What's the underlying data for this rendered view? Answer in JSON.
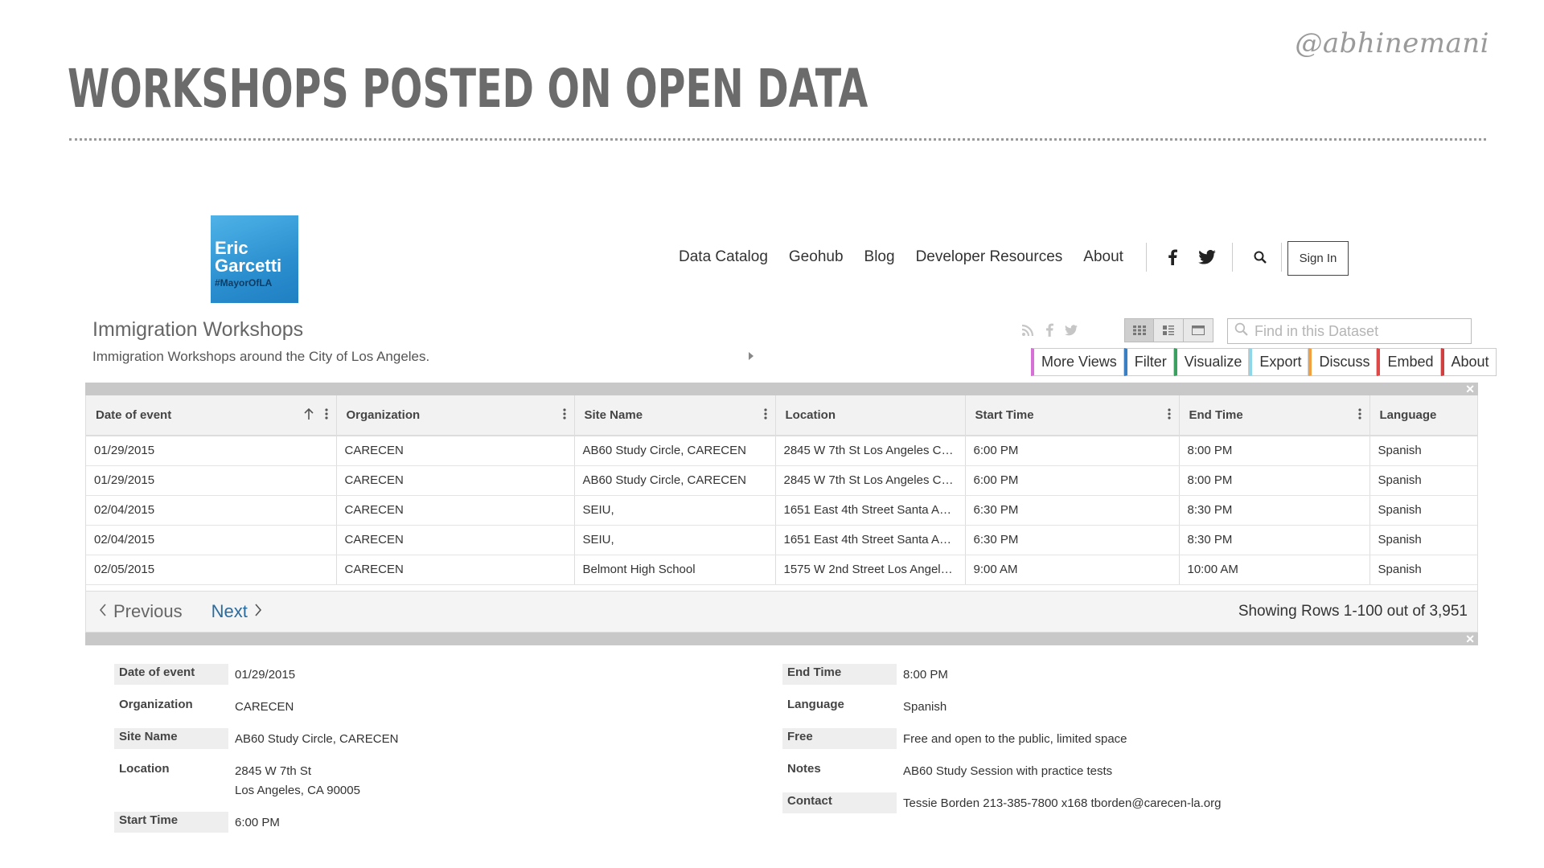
{
  "slide": {
    "handle": "@abhinemani",
    "title": "WORKSHOPS POSTED ON OPEN DATA"
  },
  "site": {
    "logo": {
      "line1": "Eric",
      "line2": "Garcetti",
      "line3": "#MayorOfLA",
      "colors": [
        "#4fb3e8",
        "#1f7fc2"
      ]
    },
    "nav": [
      "Data Catalog",
      "Geohub",
      "Blog",
      "Developer Resources",
      "About"
    ],
    "social_icons": [
      "facebook-icon",
      "twitter-icon"
    ],
    "sign_in": "Sign In"
  },
  "dataset": {
    "title": "Immigration Workshops",
    "description": "Immigration Workshops around the City of Los Angeles.",
    "search_placeholder": "Find in this Dataset",
    "share_icons": [
      "rss-icon",
      "facebook-icon",
      "twitter-icon"
    ],
    "views": [
      "table-view-icon",
      "list-view-icon",
      "page-view-icon"
    ],
    "actions": [
      {
        "label": "More Views",
        "color": "#d670d6"
      },
      {
        "label": "Filter",
        "color": "#3a7fc4"
      },
      {
        "label": "Visualize",
        "color": "#3aa060"
      },
      {
        "label": "Export",
        "color": "#8fd6e8"
      },
      {
        "label": "Discuss",
        "color": "#f0a040"
      },
      {
        "label": "Embed",
        "color": "#e04848"
      },
      {
        "label": "About",
        "color": "#d04040"
      }
    ]
  },
  "grid": {
    "columns": [
      "Date of event",
      "Organization",
      "Site Name",
      "Location",
      "Start Time",
      "End Time",
      "Language"
    ],
    "rows": [
      [
        "01/29/2015",
        "CARECEN",
        "AB60 Study Circle, CARECEN",
        "2845 W 7th St Los Angeles CA ...",
        "6:00 PM",
        "8:00 PM",
        "Spanish"
      ],
      [
        "01/29/2015",
        "CARECEN",
        "AB60 Study Circle, CARECEN",
        "2845 W 7th St Los Angeles CA ...",
        "6:00 PM",
        "8:00 PM",
        "Spanish"
      ],
      [
        "02/04/2015",
        "CARECEN",
        "SEIU,",
        "1651 East 4th Street Santa Ana...",
        "6:30 PM",
        "8:30 PM",
        "Spanish"
      ],
      [
        "02/04/2015",
        "CARECEN",
        "SEIU,",
        "1651 East 4th Street Santa Ana...",
        "6:30 PM",
        "8:30 PM",
        "Spanish"
      ],
      [
        "02/05/2015",
        "CARECEN",
        "Belmont High School",
        "1575 W 2nd Street Los Angele...",
        "9:00 AM",
        "10:00 AM",
        "Spanish"
      ]
    ]
  },
  "pager": {
    "previous": "Previous",
    "next": "Next",
    "rows_info": "Showing Rows 1-100 out of 3,951"
  },
  "details": {
    "left": [
      {
        "label": "Date of event",
        "value": "01/29/2015"
      },
      {
        "label": "Organization",
        "value": "CARECEN"
      },
      {
        "label": "Site Name",
        "value": "AB60 Study Circle, CARECEN"
      },
      {
        "label": "Location",
        "value": "2845 W 7th St",
        "value2": "Los Angeles, CA 90005"
      },
      {
        "label": "Start Time",
        "value": "6:00 PM"
      }
    ],
    "right": [
      {
        "label": "End Time",
        "value": "8:00 PM"
      },
      {
        "label": "Language",
        "value": "Spanish"
      },
      {
        "label": "Free",
        "value": "Free and open to the public, limited space"
      },
      {
        "label": "Notes",
        "value": "AB60 Study Session with practice tests"
      },
      {
        "label": "Contact",
        "value": "Tessie Borden 213-385-7800 x168 tborden@carecen-la.org"
      }
    ]
  }
}
